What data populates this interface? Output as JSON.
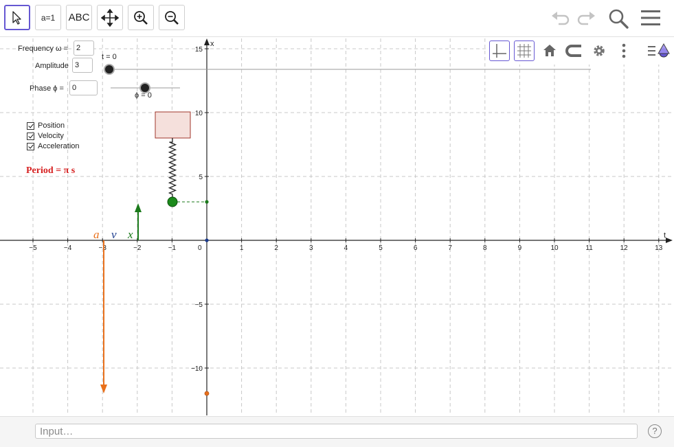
{
  "toolbar": {
    "tools": [
      {
        "name": "move-tool",
        "label": ""
      },
      {
        "name": "slider-tool",
        "label": "a=1"
      },
      {
        "name": "text-tool",
        "label": "ABC"
      },
      {
        "name": "move-graphics-view-tool",
        "label": ""
      },
      {
        "name": "zoom-in-tool",
        "label": ""
      },
      {
        "name": "zoom-out-tool",
        "label": ""
      }
    ]
  },
  "header_icons": [
    "undo-icon",
    "redo-icon",
    "search-icon",
    "menu-icon"
  ],
  "stylebar": [
    "toggle-axes-icon",
    "toggle-grid-icon",
    "home-icon",
    "point-capturing-icon",
    "settings-icon",
    "more-icon",
    "algebra-toggle-icon"
  ],
  "controls": {
    "frequency_label": "Frequency ω =",
    "frequency_value": "2",
    "amplitude_label": "Amplitude",
    "amplitude_value": "3",
    "phase_label": "Phase ϕ =",
    "phase_value": "0",
    "time_slider_label": "t = 0",
    "phase_slider_label": "ϕ = 0"
  },
  "checkboxes": [
    {
      "label": "Position",
      "checked": true
    },
    {
      "label": "Velocity",
      "checked": true
    },
    {
      "label": "Acceleration",
      "checked": true
    }
  ],
  "period_text": "Period = π s",
  "graph": {
    "x_axis_label": "t",
    "y_axis_label": "x",
    "x_ticks": [
      "−5",
      "−4",
      "−3",
      "−2",
      "−1",
      "0",
      "1",
      "2",
      "3",
      "4",
      "5",
      "6",
      "7",
      "8",
      "9",
      "10",
      "11",
      "12",
      "13"
    ],
    "y_ticks": [
      "15",
      "10",
      "5",
      "−5",
      "−10"
    ],
    "vector_labels": {
      "a": "a",
      "v": "v",
      "x": "x"
    },
    "colors": {
      "acceleration": "#e8701b",
      "velocity": "#1a3a8c",
      "position": "#1b7a1b",
      "mass_fill": "#f5e0dc",
      "mass_stroke": "#a0352a",
      "grid": "#c8c8c8"
    }
  },
  "input_bar": {
    "placeholder": "Input…"
  },
  "help": "?"
}
